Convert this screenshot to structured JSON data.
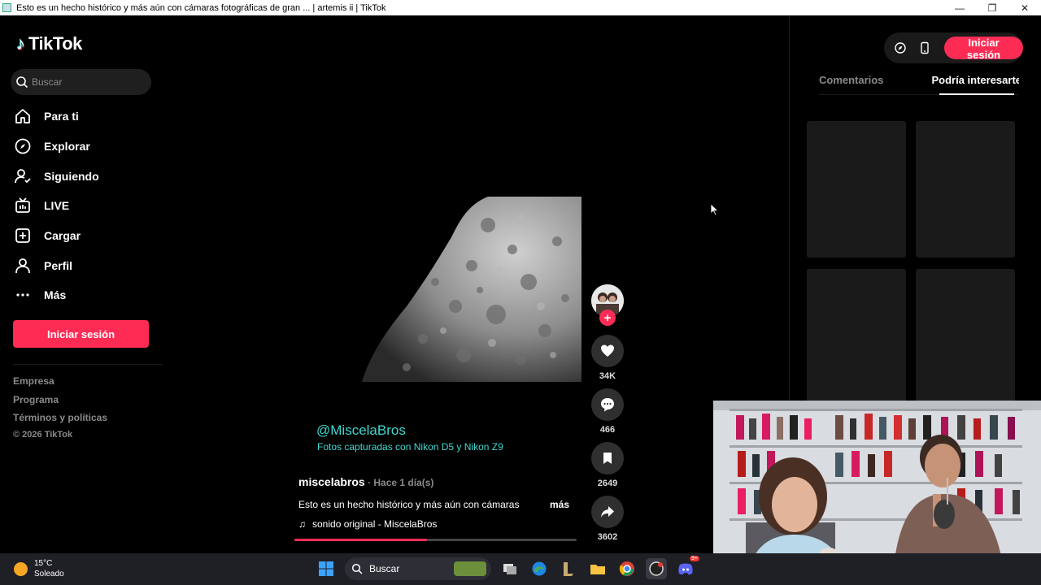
{
  "window": {
    "title": "Esto es un hecho histórico y más aún con cámaras fotográficas de gran ... | artemis ii | TikTok",
    "minimize_icon": "minimize-icon",
    "maximize_icon": "restore-icon",
    "close_icon": "close-icon"
  },
  "sidebar": {
    "logo_text": "TikTok",
    "search": {
      "placeholder": "Buscar"
    },
    "nav": [
      {
        "label": "Para ti",
        "icon": "home-icon"
      },
      {
        "label": "Explorar",
        "icon": "compass-icon"
      },
      {
        "label": "Siguiendo",
        "icon": "following-icon"
      },
      {
        "label": "LIVE",
        "icon": "live-icon"
      },
      {
        "label": "Cargar",
        "icon": "upload-icon"
      },
      {
        "label": "Perfil",
        "icon": "profile-icon"
      },
      {
        "label": "Más",
        "icon": "more-dots-icon"
      }
    ],
    "login_label": "Iniciar sesión",
    "footer_links": [
      "Empresa",
      "Programa",
      "Términos y políticas"
    ],
    "copyright": "© 2026 TikTok"
  },
  "video": {
    "overlay_handle": "@MiscelaBros",
    "overlay_caption": "Fotos capturadas con Nikon D5 y Nikon Z9",
    "author": "miscelabros",
    "time_ago": " · Hace 1 día(s)",
    "description": "Esto es un hecho histórico y más aún con cámaras",
    "more_label": "más",
    "music": "sonido original - MiscelaBros",
    "progress": 0.47
  },
  "actions": {
    "follow_label": "+",
    "likes": "34K",
    "comments": "466",
    "saves": "2649",
    "shares": "3602"
  },
  "right_panel": {
    "login_label": "Iniciar sesión",
    "tabs": [
      "Comentarios",
      "Podría interesarte"
    ],
    "active_tab": 1
  },
  "taskbar": {
    "temperature": "15°C",
    "condition": "Soleado",
    "search_label": "Buscar",
    "discord_badge": "9+"
  },
  "colors": {
    "accent": "#fe2c55",
    "overlay_text": "#3fd8d0",
    "background": "#000000"
  }
}
